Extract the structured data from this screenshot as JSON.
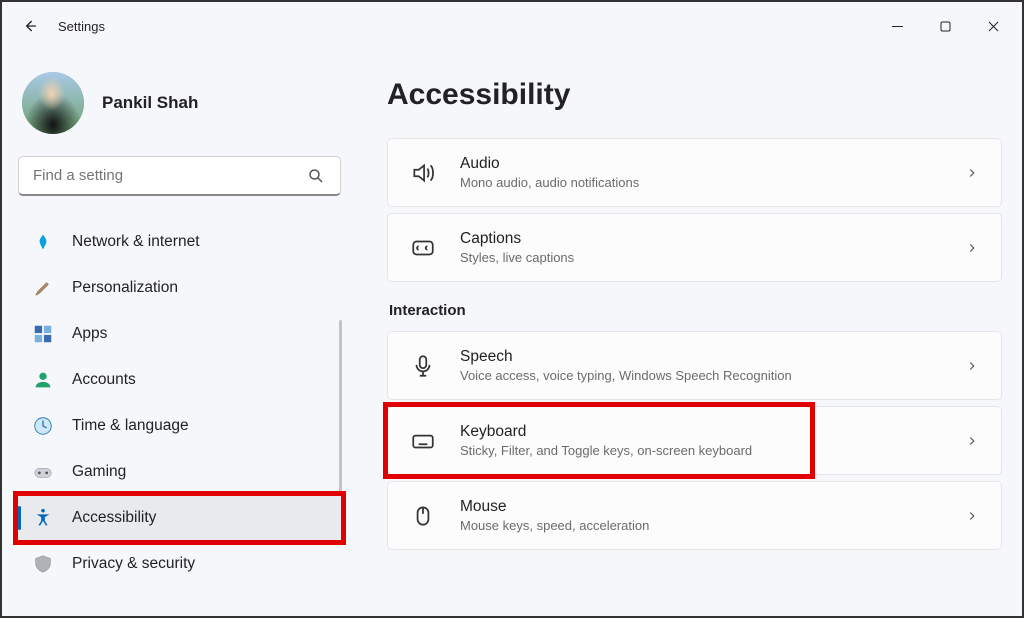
{
  "app": {
    "title": "Settings"
  },
  "user": {
    "name": "Pankil Shah"
  },
  "search": {
    "placeholder": "Find a setting"
  },
  "sidebar": {
    "items": [
      {
        "label": "Network & internet",
        "icon": "network"
      },
      {
        "label": "Personalization",
        "icon": "brush"
      },
      {
        "label": "Apps",
        "icon": "apps"
      },
      {
        "label": "Accounts",
        "icon": "accounts"
      },
      {
        "label": "Time & language",
        "icon": "time"
      },
      {
        "label": "Gaming",
        "icon": "gaming"
      },
      {
        "label": "Accessibility",
        "icon": "accessibility",
        "selected": true,
        "highlighted": true
      },
      {
        "label": "Privacy & security",
        "icon": "privacy"
      }
    ]
  },
  "main": {
    "title": "Accessibility",
    "section1_cards": [
      {
        "title": "Audio",
        "sub": "Mono audio, audio notifications",
        "icon": "audio"
      },
      {
        "title": "Captions",
        "sub": "Styles, live captions",
        "icon": "captions"
      }
    ],
    "section2_label": "Interaction",
    "section2_cards": [
      {
        "title": "Speech",
        "sub": "Voice access, voice typing, Windows Speech Recognition",
        "icon": "speech"
      },
      {
        "title": "Keyboard",
        "sub": "Sticky, Filter, and Toggle keys, on-screen keyboard",
        "icon": "keyboard",
        "highlighted": true
      },
      {
        "title": "Mouse",
        "sub": "Mouse keys, speed, acceleration",
        "icon": "mouse"
      }
    ]
  }
}
